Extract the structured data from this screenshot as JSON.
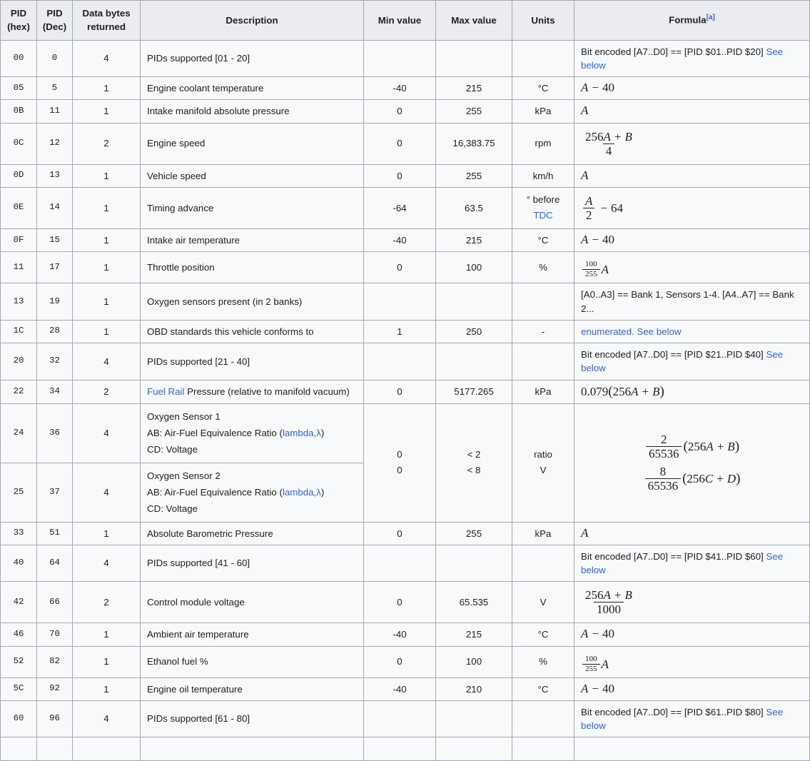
{
  "table": {
    "headers": [
      {
        "line1": "PID",
        "line2": "(hex)",
        "name": "pid-hex"
      },
      {
        "line1": "PID",
        "line2": "(Dec)",
        "name": "pid-dec"
      },
      {
        "line1": "Data bytes",
        "line2": "returned",
        "name": "data-bytes-returned"
      },
      {
        "line1": "Description",
        "line2": "",
        "name": "description"
      },
      {
        "line1": "Min value",
        "line2": "",
        "name": "min-value"
      },
      {
        "line1": "Max value",
        "line2": "",
        "name": "max-value"
      },
      {
        "line1": "Units",
        "line2": "",
        "name": "units"
      },
      {
        "line1": "Formula",
        "line2": "",
        "ref": "[a]",
        "name": "formula"
      }
    ],
    "rows": [
      {
        "hex": "00",
        "dec": "0",
        "bytes": "4",
        "desc": "PIDs supported [01 - 20]",
        "min": "",
        "max": "",
        "units": "",
        "formula_text": "Bit encoded [A7..D0] == [PID $01..PID $20] ",
        "formula_link": "See below"
      },
      {
        "hex": "05",
        "dec": "5",
        "bytes": "1",
        "desc": "Engine coolant temperature",
        "min": "-40",
        "max": "215",
        "units": "°C",
        "formula_math": "A - 40"
      },
      {
        "hex": "0B",
        "dec": "11",
        "bytes": "1",
        "desc": "Intake manifold absolute pressure",
        "min": "0",
        "max": "255",
        "units": "kPa",
        "formula_math": "A"
      },
      {
        "hex": "0C",
        "dec": "12",
        "bytes": "2",
        "desc": "Engine speed",
        "min": "0",
        "max": "16,383.75",
        "units": "rpm",
        "formula_math": "(256A + B) / 4"
      },
      {
        "hex": "0D",
        "dec": "13",
        "bytes": "1",
        "desc": "Vehicle speed",
        "min": "0",
        "max": "255",
        "units": "km/h",
        "formula_math": "A"
      },
      {
        "hex": "0E",
        "dec": "14",
        "bytes": "1",
        "desc": "Timing advance",
        "min": "-64",
        "max": "63.5",
        "units_pre": "° before",
        "units_link": "TDC",
        "formula_math": "A/2 - 64"
      },
      {
        "hex": "0F",
        "dec": "15",
        "bytes": "1",
        "desc": "Intake air temperature",
        "min": "-40",
        "max": "215",
        "units": "°C",
        "formula_math": "A - 40"
      },
      {
        "hex": "11",
        "dec": "17",
        "bytes": "1",
        "desc": "Throttle position",
        "min": "0",
        "max": "100",
        "units": "%",
        "formula_math": "(100/255)A"
      },
      {
        "hex": "13",
        "dec": "19",
        "bytes": "1",
        "desc": "Oxygen sensors present (in 2 banks)",
        "min": "",
        "max": "",
        "units": "",
        "formula_text": "[A0..A3] == Bank 1, Sensors 1-4. [A4..A7] == Bank 2..."
      },
      {
        "hex": "1C",
        "dec": "28",
        "bytes": "1",
        "desc": "OBD standards this vehicle conforms to",
        "min": "1",
        "max": "250",
        "units": "-",
        "formula_link_full": "enumerated. See below"
      },
      {
        "hex": "20",
        "dec": "32",
        "bytes": "4",
        "desc": "PIDs supported [21 - 40]",
        "min": "",
        "max": "",
        "units": "",
        "formula_text": "Bit encoded [A7..D0] == [PID $21..PID $40] ",
        "formula_link": "See below"
      },
      {
        "hex": "22",
        "dec": "34",
        "bytes": "2",
        "desc_link": "Fuel Rail",
        "desc_rest": " Pressure (relative to manifold vacuum)",
        "min": "0",
        "max": "5177.265",
        "units": "kPa",
        "formula_math": "0.079(256A + B)"
      },
      {
        "hex": "24",
        "dec": "36",
        "bytes": "4",
        "desc_lines": [
          "Oxygen Sensor 1",
          "AB: Air-Fuel Equivalence Ratio (",
          "CD: Voltage"
        ],
        "desc_lambda_link": "lambda,λ",
        "min": "0",
        "max": "< 2",
        "units": "ratio"
      },
      {
        "hex": "25",
        "dec": "37",
        "bytes": "4",
        "desc_lines": [
          "Oxygen Sensor 2",
          "AB: Air-Fuel Equivalence Ratio (",
          "CD: Voltage"
        ],
        "desc_lambda_link": "lambda,λ",
        "min": "0",
        "max": "< 8",
        "units": "V"
      },
      {
        "hex": "33",
        "dec": "51",
        "bytes": "1",
        "desc": "Absolute Barometric Pressure",
        "min": "0",
        "max": "255",
        "units": "kPa",
        "formula_math": "A"
      },
      {
        "hex": "40",
        "dec": "64",
        "bytes": "4",
        "desc": "PIDs supported [41 - 60]",
        "min": "",
        "max": "",
        "units": "",
        "formula_text": "Bit encoded [A7..D0] == [PID $41..PID $60] ",
        "formula_link": "See below"
      },
      {
        "hex": "42",
        "dec": "66",
        "bytes": "2",
        "desc": "Control module voltage",
        "min": "0",
        "max": "65.535",
        "units": "V",
        "formula_math": "(256A + B)/1000"
      },
      {
        "hex": "46",
        "dec": "70",
        "bytes": "1",
        "desc": "Ambient air temperature",
        "min": "-40",
        "max": "215",
        "units": "°C",
        "formula_math": "A - 40"
      },
      {
        "hex": "52",
        "dec": "82",
        "bytes": "1",
        "desc": "Ethanol fuel %",
        "min": "0",
        "max": "100",
        "units": "%",
        "formula_math": "(100/255)A"
      },
      {
        "hex": "5C",
        "dec": "92",
        "bytes": "1",
        "desc": "Engine oil temperature",
        "min": "-40",
        "max": "210",
        "units": "°C",
        "formula_math": "A - 40"
      },
      {
        "hex": "60",
        "dec": "96",
        "bytes": "4",
        "desc": "PIDs supported [61 - 80]",
        "min": "",
        "max": "",
        "units": "",
        "formula_text": "Bit encoded [A7..D0] == [PID $61..PID $80] ",
        "formula_link": "See below"
      }
    ],
    "oxygen_group": {
      "min_1": "0",
      "min_2": "0",
      "max_1": "< 2",
      "max_2": "< 8",
      "units_1": "ratio",
      "units_2": "V",
      "formula_1_num": "2",
      "formula_1_den": "65536",
      "formula_1_tail": "(256A + B)",
      "formula_2_num": "8",
      "formula_2_den": "65536",
      "formula_2_tail": "(256C + D)"
    },
    "math_symbols": {
      "A": "A",
      "B": "B",
      "C": "C",
      "D": "D",
      "minus": "−",
      "plus": "+",
      "n40": "40",
      "n64": "64",
      "n2": "2",
      "n4": "4",
      "n100": "100",
      "n255": "255",
      "n256": "256",
      "n1000": "1000",
      "n65536": "65536",
      "n0079": "0.079"
    },
    "colors": {
      "link": "#3366cc",
      "header_bg": "#eaecf0",
      "cell_bg": "#f8f9fa",
      "border": "#a2a9b1",
      "text": "#202122"
    }
  }
}
